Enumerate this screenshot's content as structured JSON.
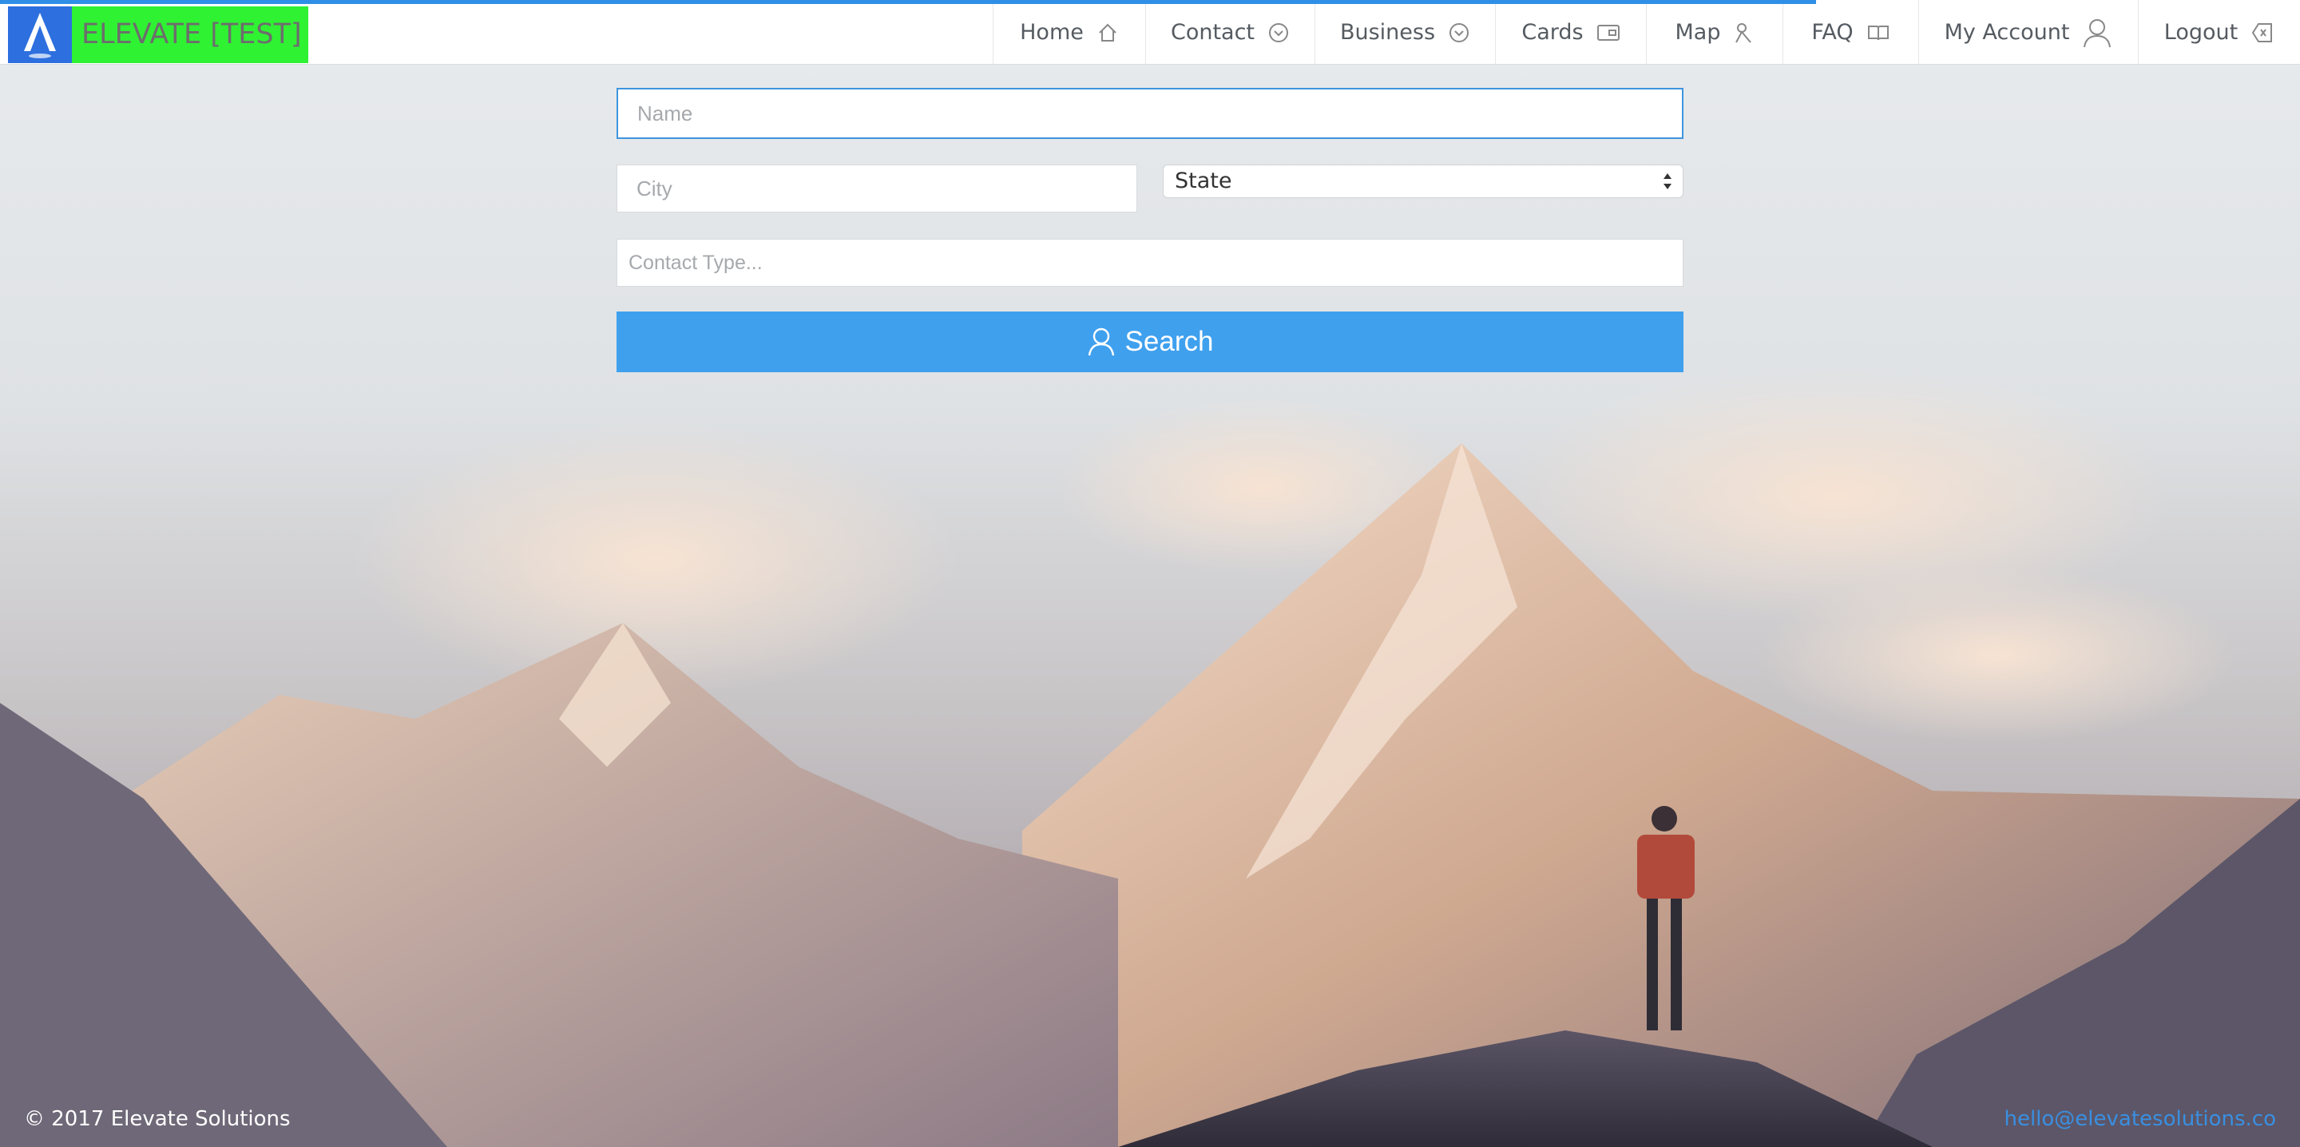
{
  "brand": {
    "name": "ELEVATE [TEST]"
  },
  "nav": {
    "items": [
      {
        "label": "Home",
        "icon": "home-icon"
      },
      {
        "label": "Contact",
        "icon": "chevron-circle-down-icon"
      },
      {
        "label": "Business",
        "icon": "chevron-circle-down-icon"
      },
      {
        "label": "Cards",
        "icon": "card-icon"
      },
      {
        "label": "Map",
        "icon": "map-pin-icon"
      },
      {
        "label": "FAQ",
        "icon": "book-icon"
      },
      {
        "label": "My Account",
        "icon": "user-icon"
      },
      {
        "label": "Logout",
        "icon": "logout-icon"
      }
    ]
  },
  "form": {
    "name_placeholder": "Name",
    "city_placeholder": "City",
    "state_value": "State",
    "contact_type_placeholder": "Contact Type...",
    "search_label": "Search"
  },
  "footer": {
    "copyright": "© 2017 Elevate Solutions",
    "email": "hello@elevatesolutions.co"
  },
  "colors": {
    "accent": "#3fa0ee",
    "brand_box": "#2ff233",
    "logo_box": "#2d6fde",
    "link": "#3a8fe0"
  }
}
